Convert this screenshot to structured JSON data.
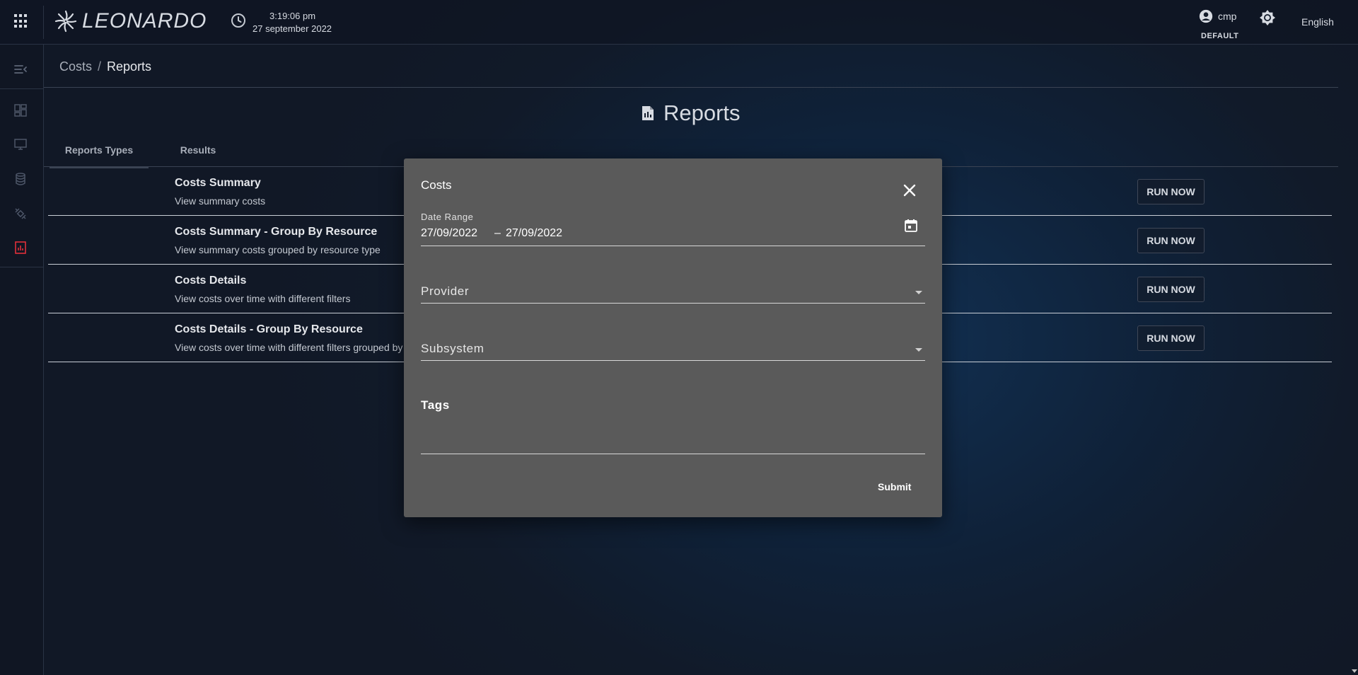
{
  "topbar": {
    "logo_text": "LEONARDO",
    "time": "3:19:06 pm",
    "date": "27 september 2022",
    "user_name": "cmp",
    "user_role": "DEFAULT",
    "language": "English"
  },
  "sidebar": {
    "items": [
      {
        "icon": "collapse-menu-icon"
      },
      {
        "icon": "dashboard-icon"
      },
      {
        "icon": "monitor-icon"
      },
      {
        "icon": "database-icon"
      },
      {
        "icon": "satellite-icon"
      },
      {
        "icon": "reports-icon",
        "active": true
      }
    ],
    "accent_color": "#e0303a"
  },
  "breadcrumb": {
    "parent": "Costs",
    "separator": "/",
    "current": "Reports"
  },
  "page": {
    "title": "Reports",
    "tabs": [
      {
        "label": "Reports Types",
        "active": true
      },
      {
        "label": "Results",
        "active": false
      }
    ]
  },
  "reports": [
    {
      "title": "Costs Summary",
      "description": "View summary costs",
      "action": "RUN NOW"
    },
    {
      "title": "Costs Summary - Group By Resource",
      "description": "View summary costs grouped by resource type",
      "action": "RUN NOW"
    },
    {
      "title": "Costs Details",
      "description": "View costs over time with different filters",
      "action": "RUN NOW"
    },
    {
      "title": "Costs Details - Group By Resource",
      "description": "View costs over time with different filters grouped by",
      "action": "RUN NOW"
    }
  ],
  "modal": {
    "title": "Costs",
    "date_range_label": "Date Range",
    "date_start": "27/09/2022",
    "date_separator": "–",
    "date_end": "27/09/2022",
    "provider_label": "Provider",
    "subsystem_label": "Subsystem",
    "tags_label": "Tags",
    "submit_label": "Submit",
    "background": "#5a5a5a"
  }
}
